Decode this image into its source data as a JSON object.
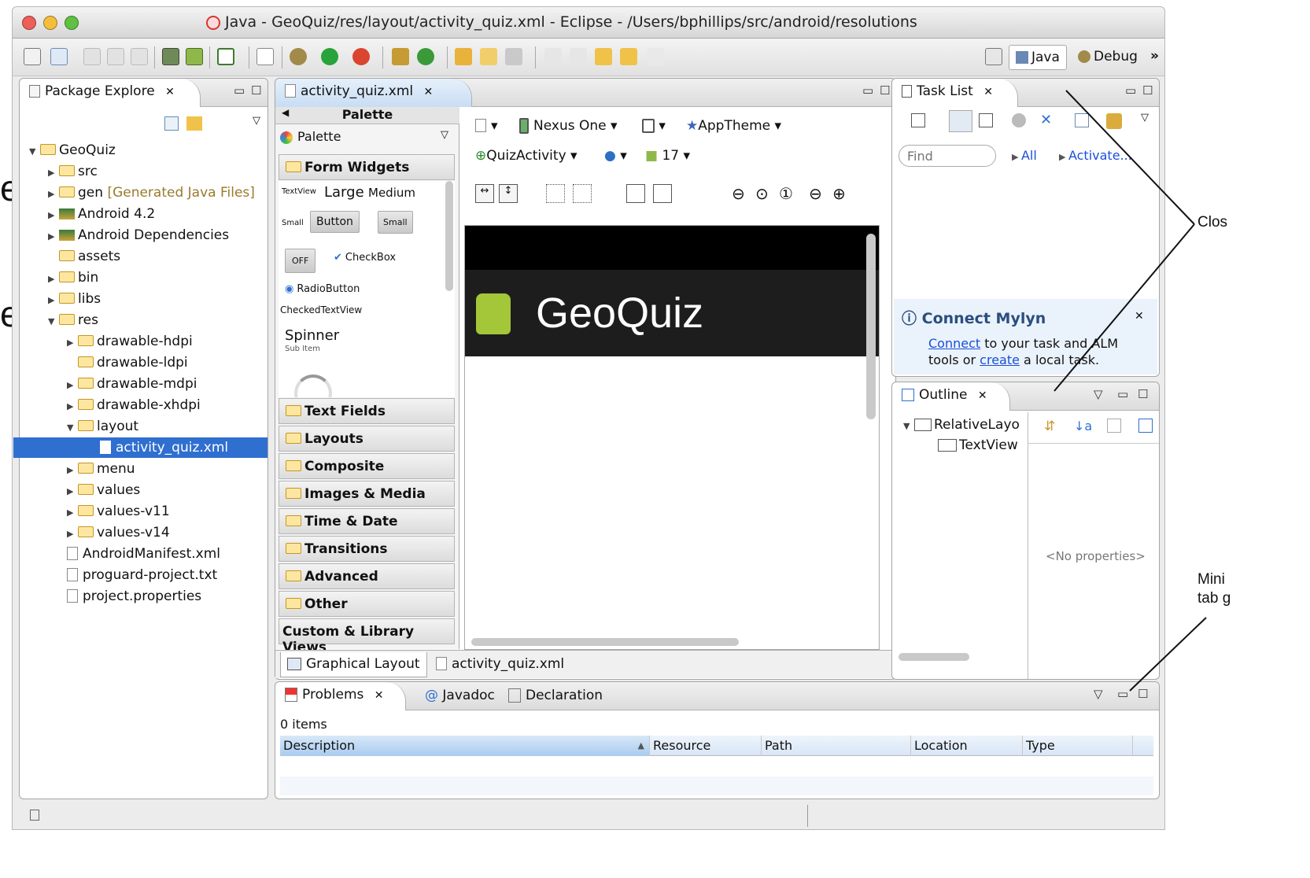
{
  "window": {
    "title": "Java - GeoQuiz/res/layout/activity_quiz.xml - Eclipse - /Users/bphillips/src/android/resolutions",
    "perspectives": [
      "Java",
      "Debug"
    ]
  },
  "package_explorer": {
    "tab_label": "Package Explore",
    "tree": [
      {
        "label": "GeoQuiz",
        "suffix": "",
        "twisty": "▼"
      },
      {
        "label": "src",
        "suffix": "",
        "twisty": "▶"
      },
      {
        "label": "gen",
        "suffix": "[Generated Java Files]",
        "twisty": "▶"
      },
      {
        "label": "Android 4.2",
        "suffix": "",
        "twisty": "▶"
      },
      {
        "label": "Android Dependencies",
        "suffix": "",
        "twisty": "▶"
      },
      {
        "label": "assets",
        "suffix": "",
        "twisty": ""
      },
      {
        "label": "bin",
        "suffix": "",
        "twisty": "▶"
      },
      {
        "label": "libs",
        "suffix": "",
        "twisty": "▶"
      },
      {
        "label": "res",
        "suffix": "",
        "twisty": "▼"
      },
      {
        "label": "drawable-hdpi",
        "suffix": "",
        "twisty": "▶"
      },
      {
        "label": "drawable-ldpi",
        "suffix": "",
        "twisty": ""
      },
      {
        "label": "drawable-mdpi",
        "suffix": "",
        "twisty": "▶"
      },
      {
        "label": "drawable-xhdpi",
        "suffix": "",
        "twisty": "▶"
      },
      {
        "label": "layout",
        "suffix": "",
        "twisty": "▼"
      },
      {
        "label": "activity_quiz.xml",
        "suffix": "",
        "twisty": ""
      },
      {
        "label": "menu",
        "suffix": "",
        "twisty": "▶"
      },
      {
        "label": "values",
        "suffix": "",
        "twisty": "▶"
      },
      {
        "label": "values-v11",
        "suffix": "",
        "twisty": "▶"
      },
      {
        "label": "values-v14",
        "suffix": "",
        "twisty": "▶"
      },
      {
        "label": "AndroidManifest.xml",
        "suffix": "",
        "twisty": ""
      },
      {
        "label": "proguard-project.txt",
        "suffix": "",
        "twisty": ""
      },
      {
        "label": "project.properties",
        "suffix": "",
        "twisty": ""
      }
    ]
  },
  "editor": {
    "tab_label": "activity_quiz.xml",
    "palette": {
      "header": "Palette",
      "dropdown": "Palette",
      "open_section": "Form Widgets",
      "widgets": {
        "textview_tag": "TextView",
        "large": "Large",
        "medium": "Medium",
        "small_tag": "Small",
        "button": "Button",
        "small_button": "Small",
        "toggle_off": "OFF",
        "checkbox": "CheckBox",
        "radiobutton": "RadioButton",
        "checked_textview": "CheckedTextView",
        "spinner": "Spinner",
        "sub_item": "Sub Item"
      },
      "sections": [
        "Text Fields",
        "Layouts",
        "Composite",
        "Images & Media",
        "Time & Date",
        "Transitions",
        "Advanced",
        "Other"
      ],
      "custom": "Custom & Library Views"
    },
    "config": {
      "device": "Nexus One",
      "theme": "AppTheme",
      "activity": "QuizActivity",
      "api": "17"
    },
    "preview": {
      "app_title": "GeoQuiz"
    },
    "bottom_tabs": [
      "Graphical Layout",
      "activity_quiz.xml"
    ]
  },
  "task_list": {
    "tab_label": "Task List",
    "find_placeholder": "Find",
    "filter_all": "All",
    "filter_activate": "Activate...",
    "mylyn_title": "Connect Mylyn",
    "mylyn_link_connect": "Connect",
    "mylyn_text_1": " to your task and ALM",
    "mylyn_text_2": "tools or ",
    "mylyn_link_create": "create",
    "mylyn_text_3": " a local task."
  },
  "outline": {
    "tab_label": "Outline",
    "items": [
      "RelativeLayo",
      "TextView"
    ],
    "no_properties": "<No properties>"
  },
  "problems": {
    "tabs": [
      "Problems",
      "Javadoc",
      "Declaration"
    ],
    "count": "0 items",
    "columns": [
      "Description",
      "Resource",
      "Path",
      "Location",
      "Type"
    ]
  },
  "annotations": {
    "left_top": "e",
    "left_mid": "es",
    "close": "Clos",
    "mini_1": "Mini",
    "mini_2": "tab g"
  },
  "colors": {
    "accent": "#2f6fd0",
    "selection": "#2f6fd0",
    "android_green": "#a4c639",
    "action_bar": "#1d1d1d"
  }
}
